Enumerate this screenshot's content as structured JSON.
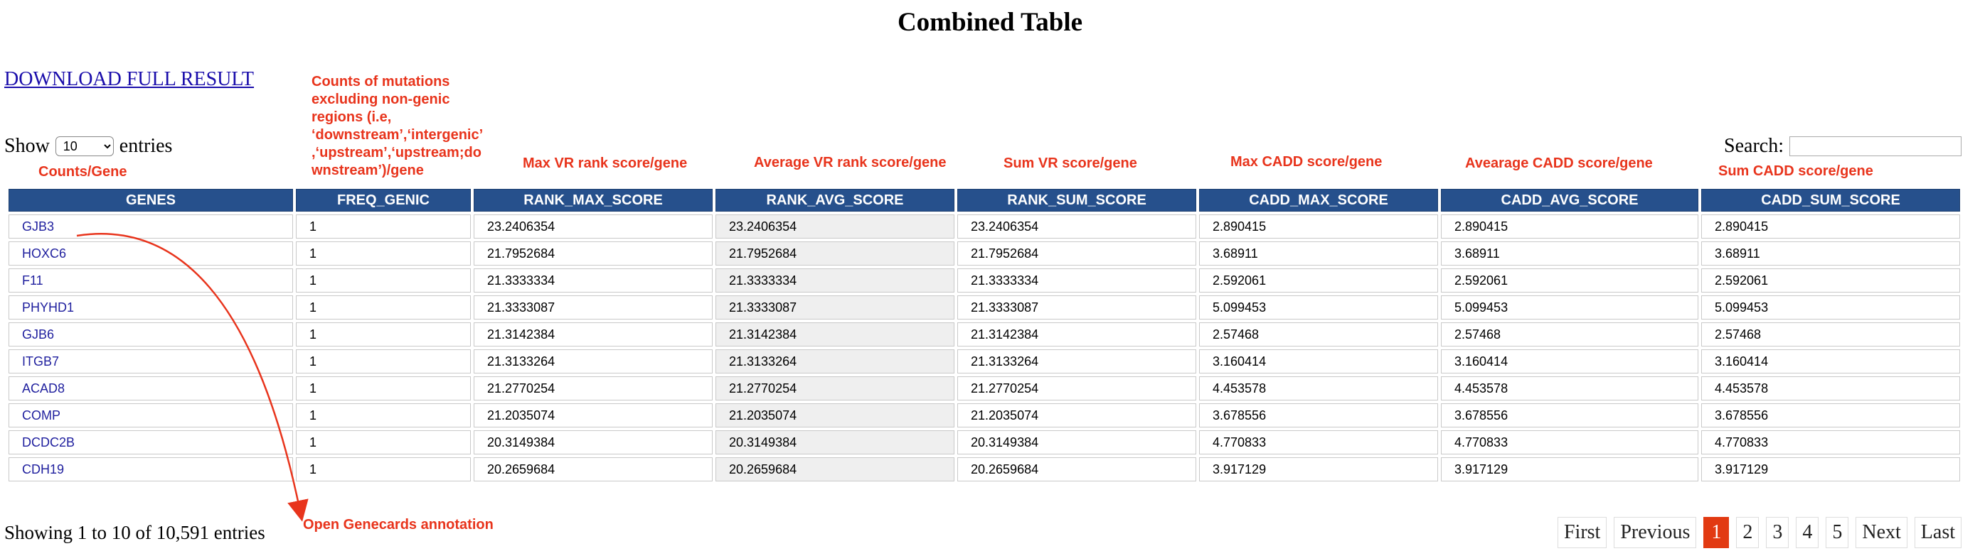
{
  "title": "Combined Table",
  "download_link": "DOWNLOAD FULL RESULT",
  "length": {
    "prefix": "Show",
    "selected": "10",
    "suffix": "entries"
  },
  "search": {
    "label": "Search:",
    "value": ""
  },
  "annotations": {
    "counts_gene": "Counts/Gene",
    "freq_note": "Counts of mutations excluding non-genic regions (i.e, ‘downstream’,‘intergenic’ ,‘upstream’,‘upstream;do wnstream’)/gene",
    "max_vr": "Max VR rank score/gene",
    "avg_vr": "Average VR rank score/gene",
    "sum_vr": "Sum VR score/gene",
    "max_cadd": "Max CADD score/gene",
    "avg_cadd": "Avearage CADD score/gene",
    "sum_cadd": "Sum CADD score/gene",
    "genecards": "Open Genecards annotation",
    "arrow_color": "#e8341c"
  },
  "table": {
    "header_color": "#26508c",
    "columns": [
      "GENES",
      "FREQ_GENIC",
      "RANK_MAX_SCORE",
      "RANK_AVG_SCORE",
      "RANK_SUM_SCORE",
      "CADD_MAX_SCORE",
      "CADD_AVG_SCORE",
      "CADD_SUM_SCORE"
    ],
    "rows": [
      [
        "GJB3",
        "1",
        "23.2406354",
        "23.2406354",
        "23.2406354",
        "2.890415",
        "2.890415",
        "2.890415"
      ],
      [
        "HOXC6",
        "1",
        "21.7952684",
        "21.7952684",
        "21.7952684",
        "3.68911",
        "3.68911",
        "3.68911"
      ],
      [
        "F11",
        "1",
        "21.3333334",
        "21.3333334",
        "21.3333334",
        "2.592061",
        "2.592061",
        "2.592061"
      ],
      [
        "PHYHD1",
        "1",
        "21.3333087",
        "21.3333087",
        "21.3333087",
        "5.099453",
        "5.099453",
        "5.099453"
      ],
      [
        "GJB6",
        "1",
        "21.3142384",
        "21.3142384",
        "21.3142384",
        "2.57468",
        "2.57468",
        "2.57468"
      ],
      [
        "ITGB7",
        "1",
        "21.3133264",
        "21.3133264",
        "21.3133264",
        "3.160414",
        "3.160414",
        "3.160414"
      ],
      [
        "ACAD8",
        "1",
        "21.2770254",
        "21.2770254",
        "21.2770254",
        "4.453578",
        "4.453578",
        "4.453578"
      ],
      [
        "COMP",
        "1",
        "21.2035074",
        "21.2035074",
        "21.2035074",
        "3.678556",
        "3.678556",
        "3.678556"
      ],
      [
        "DCDC2B",
        "1",
        "20.3149384",
        "20.3149384",
        "20.3149384",
        "4.770833",
        "4.770833",
        "4.770833"
      ],
      [
        "CDH19",
        "1",
        "20.2659684",
        "20.2659684",
        "20.2659684",
        "3.917129",
        "3.917129",
        "3.917129"
      ]
    ]
  },
  "info": "Showing 1 to 10 of 10,591 entries",
  "pagination": {
    "first": "First",
    "previous": "Previous",
    "pages": [
      "1",
      "2",
      "3",
      "4",
      "5"
    ],
    "current": "1",
    "next": "Next",
    "last": "Last",
    "current_color": "#e23a12"
  }
}
